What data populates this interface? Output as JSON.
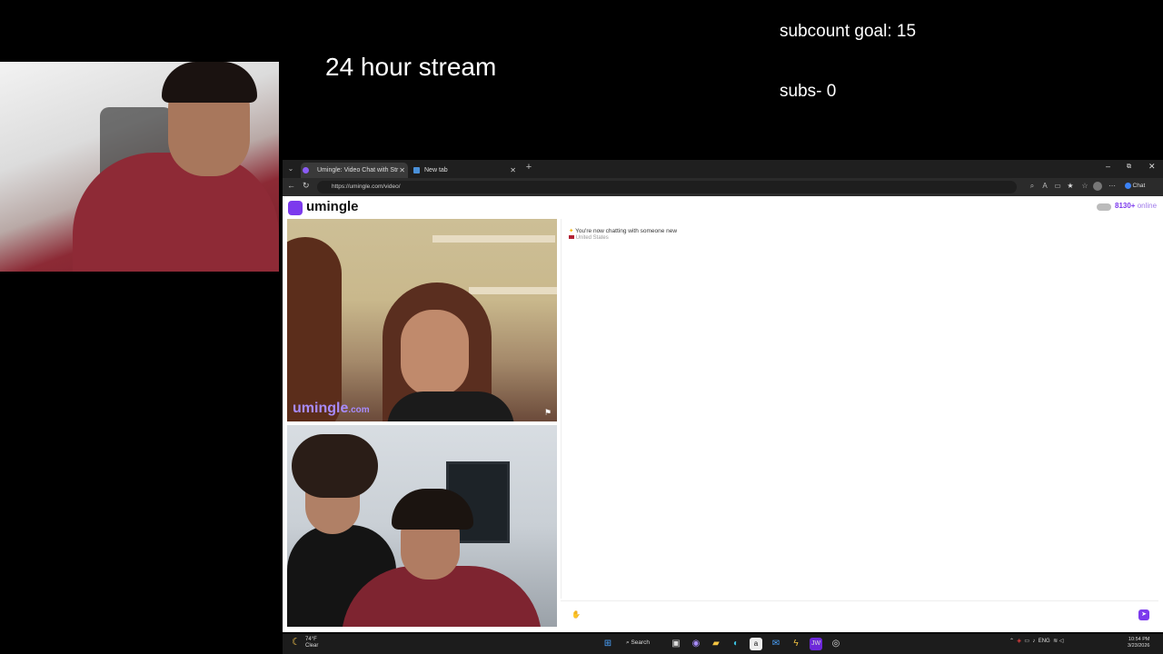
{
  "overlay": {
    "stream_title": "24 hour stream",
    "subcount_goal": "subcount goal: 15",
    "subs": "subs- 0"
  },
  "browser": {
    "tabs": [
      {
        "label": "Umingle: Video Chat with Str",
        "active": true
      },
      {
        "label": "New tab",
        "active": false
      }
    ],
    "url": "https://umingle.com/video/",
    "chat_button": "Chat"
  },
  "site": {
    "logo": "umingle",
    "online_count": "8130+",
    "online_label": "online",
    "watermark_main": "umingle",
    "watermark_suffix": ".com",
    "chat_message": "You're now chatting with someone new",
    "chat_location": "United States",
    "input_placeholder": ""
  },
  "taskbar": {
    "temperature": "74°F",
    "weather": "Clear",
    "search_label": "Search",
    "language": "ENG",
    "time": "10:54 PM",
    "date": "3/23/2026"
  },
  "colors": {
    "brand": "#7c3aed",
    "background": "#000000"
  }
}
